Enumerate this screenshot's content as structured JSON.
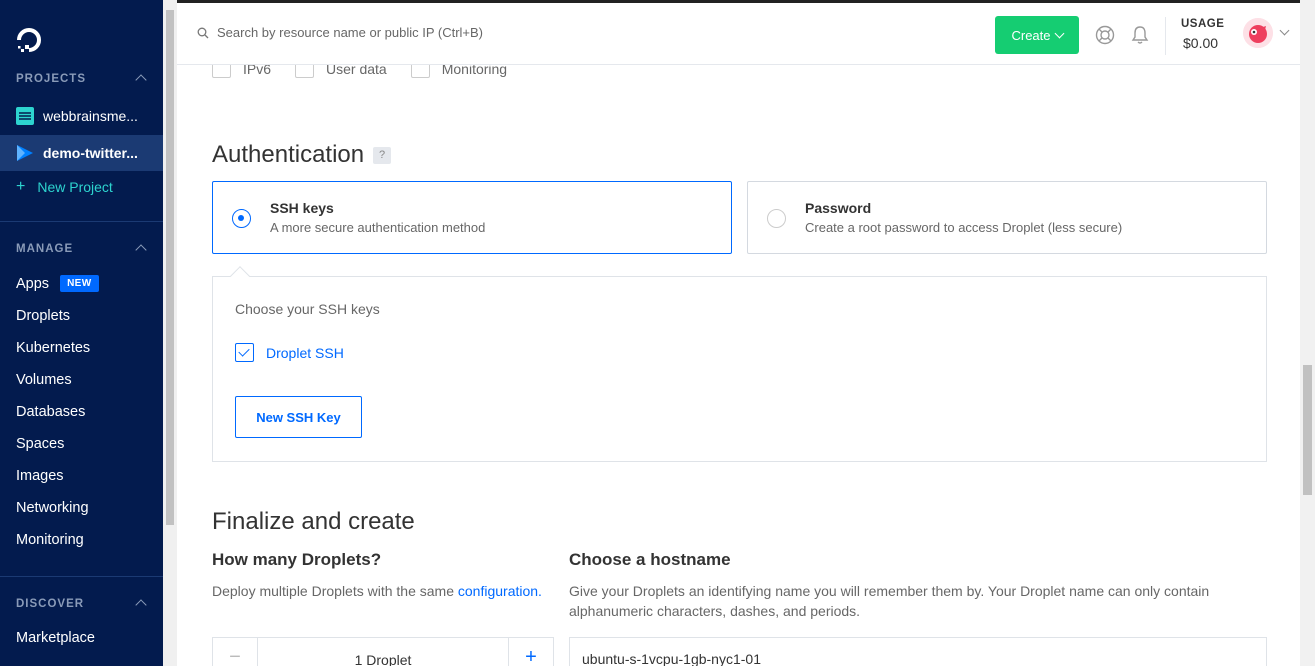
{
  "sidebar": {
    "projects_title": "PROJECTS",
    "projects": [
      {
        "label": "webbrainsme...",
        "active": false
      },
      {
        "label": "demo-twitter...",
        "active": true
      }
    ],
    "new_project": "New Project",
    "manage_title": "MANAGE",
    "nav": [
      {
        "label": "Apps",
        "badge": "NEW"
      },
      {
        "label": "Droplets"
      },
      {
        "label": "Kubernetes"
      },
      {
        "label": "Volumes"
      },
      {
        "label": "Databases"
      },
      {
        "label": "Spaces"
      },
      {
        "label": "Images"
      },
      {
        "label": "Networking"
      },
      {
        "label": "Monitoring"
      }
    ],
    "discover_title": "DISCOVER",
    "discover": [
      {
        "label": "Marketplace"
      }
    ]
  },
  "header": {
    "search_placeholder": "Search by resource name or public IP (Ctrl+B)",
    "create_label": "Create",
    "usage_label": "USAGE",
    "usage_value": "$0.00"
  },
  "options": [
    {
      "label": "IPv6"
    },
    {
      "label": "User data"
    },
    {
      "label": "Monitoring"
    }
  ],
  "authentication": {
    "title": "Authentication",
    "help": "?",
    "ssh": {
      "title": "SSH keys",
      "subtitle": "A more secure authentication method"
    },
    "password": {
      "title": "Password",
      "subtitle": "Create a root password to access Droplet (less secure)"
    },
    "choose_label": "Choose your SSH keys",
    "key_name": "Droplet SSH",
    "new_key_label": "New SSH Key"
  },
  "finalize": {
    "title": "Finalize and create",
    "count_title": "How many Droplets?",
    "count_desc": "Deploy multiple Droplets with the same ",
    "count_desc_link": "configuration.",
    "count_value": "1  Droplet",
    "hostname_title": "Choose a hostname",
    "hostname_desc": "Give your Droplets an identifying name you will remember them by. Your Droplet name can only contain alphanumeric characters, dashes, and periods.",
    "hostname_value": "ubuntu-s-1vcpu-1gb-nyc1-01"
  }
}
